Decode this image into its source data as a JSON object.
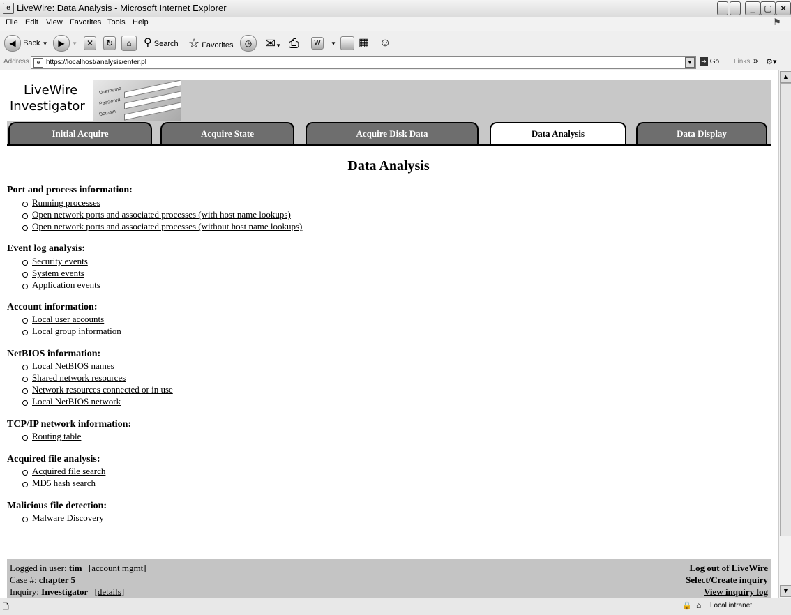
{
  "window": {
    "title": "LiveWire: Data Analysis - Microsoft Internet Explorer",
    "buttons": [
      "_",
      "▢",
      "✕"
    ]
  },
  "menu": [
    "File",
    "Edit",
    "View",
    "Favorites",
    "Tools",
    "Help"
  ],
  "toolbar": {
    "back": "Back",
    "search": "Search",
    "favorites": "Favorites"
  },
  "address": {
    "label": "Address",
    "url": "https://localhost/analysis/enter.pl",
    "go": "Go",
    "links": "Links"
  },
  "banner": {
    "logo_line1": "LiveWire",
    "logo_line2": "Investigator",
    "field_labels": [
      "Username",
      "Password",
      "Domain"
    ]
  },
  "tabs": [
    {
      "label": "Initial Acquire",
      "active": false
    },
    {
      "label": "Acquire State",
      "active": false
    },
    {
      "label": "Acquire Disk Data",
      "active": false
    },
    {
      "label": "Data Analysis",
      "active": true
    },
    {
      "label": "Data Display",
      "active": false
    }
  ],
  "page": {
    "title": "Data Analysis",
    "sections": [
      {
        "heading": "Port and process information:",
        "items": [
          {
            "label": "Running processes",
            "link": true
          },
          {
            "label": "Open network ports and associated processes (with host name lookups)",
            "link": true
          },
          {
            "label": "Open network ports and associated processes (without host name lookups)",
            "link": true
          }
        ]
      },
      {
        "heading": "Event log analysis:",
        "items": [
          {
            "label": "Security events",
            "link": true
          },
          {
            "label": "System events",
            "link": true
          },
          {
            "label": "Application events",
            "link": true
          }
        ]
      },
      {
        "heading": "Account information:",
        "items": [
          {
            "label": "Local user accounts",
            "link": true
          },
          {
            "label": "Local group information",
            "link": true
          }
        ]
      },
      {
        "heading": "NetBIOS information:",
        "items": [
          {
            "label": "Local NetBIOS names",
            "link": false
          },
          {
            "label": "Shared network resources",
            "link": true
          },
          {
            "label": "Network resources connected or in use",
            "link": true
          },
          {
            "label": "Local NetBIOS network",
            "link": true
          }
        ]
      },
      {
        "heading": "TCP/IP network information:",
        "items": [
          {
            "label": "Routing table",
            "link": true
          }
        ]
      },
      {
        "heading": "Acquired file analysis:",
        "items": [
          {
            "label": "Acquired file search",
            "link": true
          },
          {
            "label": "MD5 hash search",
            "link": true
          }
        ]
      },
      {
        "heading": "Malicious file detection:",
        "items": [
          {
            "label": "Malware Discovery",
            "link": true
          }
        ]
      }
    ]
  },
  "footer": {
    "user_label": "Logged in user:",
    "user": "tim",
    "account_link": "[account mgmt]",
    "case_label": "Case #:",
    "case": "chapter 5",
    "inquiry_label": "Inquiry:",
    "inquiry": "Investigator",
    "details_link": "[details]",
    "logout": "Log out of LiveWire",
    "select_inquiry": "Select/Create inquiry",
    "view_log": "View inquiry log"
  },
  "status": {
    "zone": "Local intranet"
  }
}
